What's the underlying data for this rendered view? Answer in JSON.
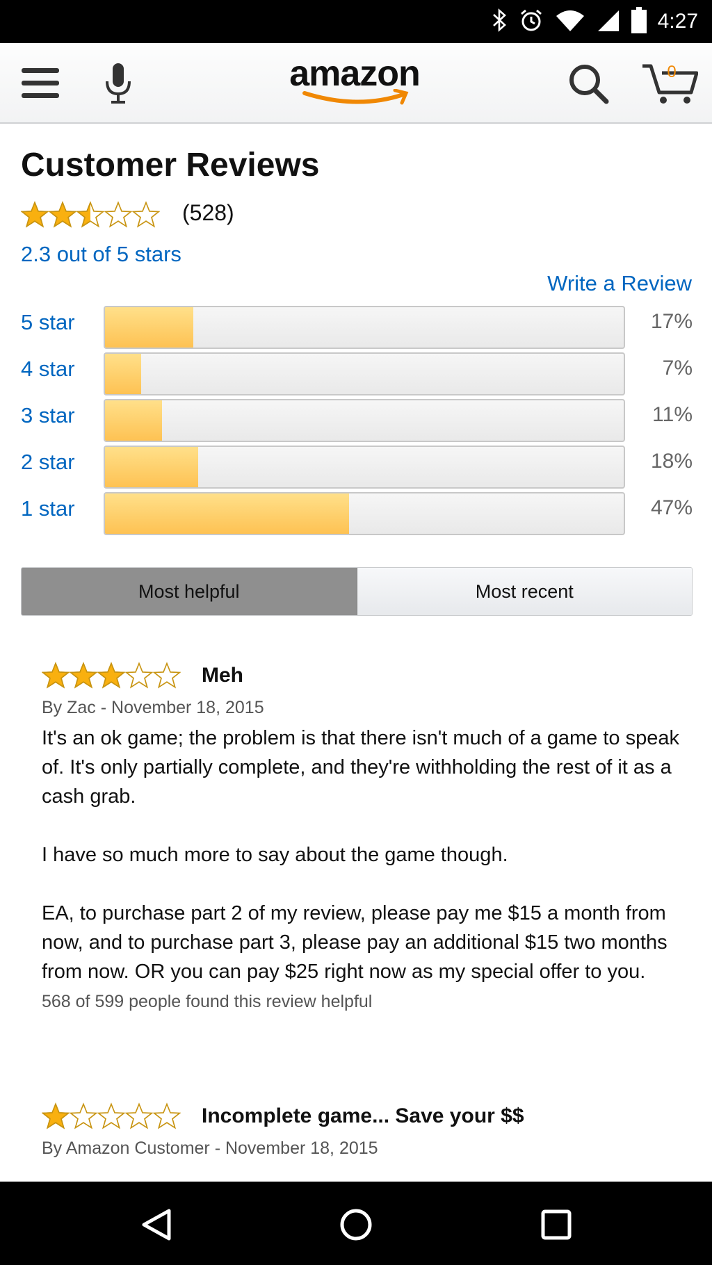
{
  "status_bar": {
    "time": "4:27",
    "icons": [
      "bluetooth-icon",
      "alarm-icon",
      "wifi-icon",
      "signal-icon",
      "battery-icon"
    ]
  },
  "header": {
    "logo_text": "amazon",
    "cart_count": "0",
    "icons": [
      "menu-icon",
      "microphone-icon",
      "search-icon",
      "cart-icon"
    ]
  },
  "reviews_summary": {
    "title": "Customer Reviews",
    "average_rating": 2.3,
    "review_count": "(528)",
    "average_label": "2.3 out of 5 stars",
    "write_review_label": "Write a Review",
    "histogram": [
      {
        "label": "5 star",
        "percent": 17,
        "percent_label": "17%"
      },
      {
        "label": "4 star",
        "percent": 7,
        "percent_label": "7%"
      },
      {
        "label": "3 star",
        "percent": 11,
        "percent_label": "11%"
      },
      {
        "label": "2 star",
        "percent": 18,
        "percent_label": "18%"
      },
      {
        "label": "1 star",
        "percent": 47,
        "percent_label": "47%"
      }
    ]
  },
  "sort_tabs": {
    "active": "Most helpful",
    "most_helpful": "Most helpful",
    "most_recent": "Most recent"
  },
  "reviews": [
    {
      "rating": 3,
      "title": "Meh",
      "byline": "By Zac - November 18, 2015",
      "paragraphs": [
        "It's an ok game; the problem is that there isn't much of a game to speak of. It's only partially complete, and they're withholding the rest of it as a cash grab.",
        "I have so much more to say about the game though.",
        "EA, to purchase part 2 of my review, please pay me $15 a month from now, and to purchase part 3, please pay an additional $15 two months from now. OR you can pay $25 right now as my special offer to you."
      ],
      "helpful": "568 of 599 people found this review helpful"
    },
    {
      "rating": 1,
      "title": "Incomplete game... Save your $$",
      "byline": "By Amazon Customer - November 18, 2015"
    }
  ],
  "colors": {
    "link": "#0066c0",
    "star": "#f9b00f",
    "bar_fill": "#fec253",
    "amazon_smile": "#f08804"
  },
  "nav_bar": {
    "icons": [
      "back-icon",
      "home-icon",
      "recents-icon"
    ]
  }
}
